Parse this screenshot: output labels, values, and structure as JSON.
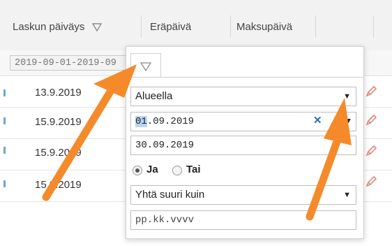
{
  "table": {
    "columns": [
      {
        "label": "Laskun päiväys",
        "filter_icon": "filter-icon"
      },
      {
        "label": "Eräpäivä"
      },
      {
        "label": "Maksupäivä"
      }
    ],
    "date_range_value": "2019-09-01-2019-09",
    "rows": [
      {
        "date": "13.9.2019"
      },
      {
        "date": "15.9.2019"
      },
      {
        "date": "15.9.2019"
      },
      {
        "date": "15.9.2019"
      }
    ],
    "row_action_icon": "pencil-icon"
  },
  "filter_popup": {
    "tab_icon": "filter-icon",
    "mode_select": "Alueella",
    "start_date_selected": "01",
    "start_date_rest": ".09.2019",
    "end_date": "30.09.2019",
    "logic": {
      "and_label": "Ja",
      "or_label": "Tai",
      "selected": "Ja"
    },
    "condition_select": "Yhtä suuri kuin",
    "value_placeholder": "pp.kk.vvvv"
  },
  "colors": {
    "arrow": "#f58a2b",
    "pencil": "#e08a7a",
    "accent": "#2d6fb5"
  }
}
